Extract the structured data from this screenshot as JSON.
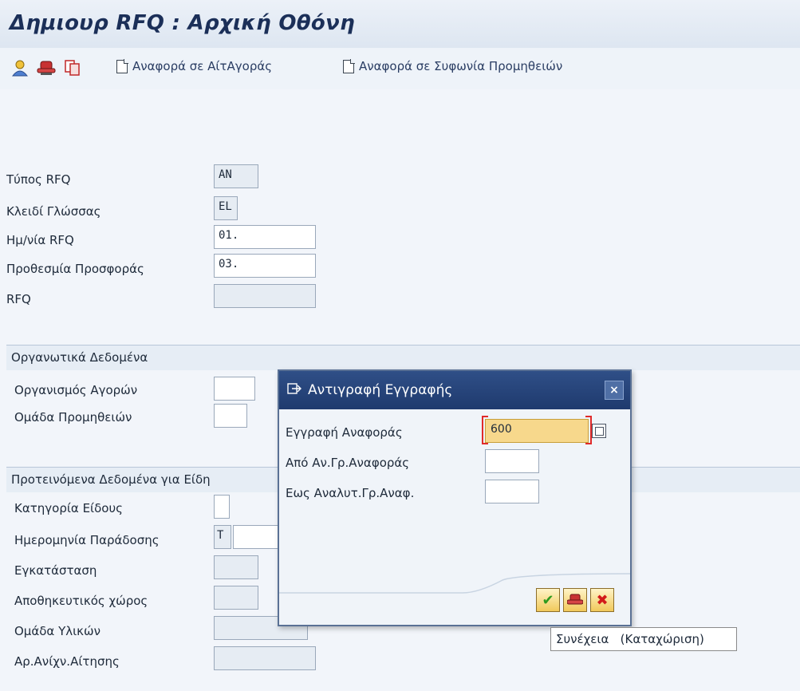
{
  "window": {
    "title": "Δημιουρ RFQ : Αρχική Οθόνη"
  },
  "toolbar": {
    "icons": [
      "person-icon",
      "hat-icon",
      "copy-icon"
    ],
    "btn_ref_request": "Αναφορά σε ΑίτΑγοράς",
    "btn_ref_agreement": "Αναφορά σε Συφωνία Προμηθειών"
  },
  "header_fields": {
    "rfq_type_label": "Τύπος RFQ",
    "rfq_type_value": "AN",
    "language_label": "Κλειδί Γλώσσας",
    "language_value": "EL",
    "rfq_date_label": "Ημ/νία RFQ",
    "rfq_date_value": "01.",
    "deadline_label": "Προθεσμία Προσφοράς",
    "deadline_value": "03.",
    "rfq_label": "RFQ",
    "rfq_value": ""
  },
  "org_section": {
    "title": "Οργανωτικά Δεδομένα",
    "purch_org_label": "Οργανισμός Αγορών",
    "purch_org_value": "",
    "purch_group_label": "Ομάδα Προμηθειών",
    "purch_group_value": ""
  },
  "item_section": {
    "title": "Προτεινόμενα Δεδομένα για Είδη",
    "item_cat_label": "Κατηγορία Είδους",
    "item_cat_value": "",
    "delivery_label": "Ημερομηνία Παράδοσης",
    "delivery_type_value": "T",
    "delivery_date_value": "",
    "plant_label": "Εγκατάσταση",
    "plant_value": "",
    "storage_label": "Αποθηκευτικός χώρος",
    "storage_value": "",
    "mat_group_label": "Ομάδα Υλικών",
    "mat_group_value": "",
    "req_no_label": "Αρ.Ανίχν.Αίτησης",
    "req_no_value": ""
  },
  "dialog": {
    "title": "Αντιγραφή Εγγραφής",
    "ref_doc_label": "Εγγραφή Αναφοράς",
    "ref_doc_value": "600",
    "from_item_label": "Από Αν.Γρ.Αναφοράς",
    "from_item_value": "",
    "to_item_label": "Εως Αναλυτ.Γρ.Αναφ.",
    "to_item_value": ""
  },
  "tooltip": {
    "text": "Συνέχεια   (Καταχώριση)"
  },
  "colors": {
    "title_text": "#1b2f58",
    "dialog_header": "#1f3a6e",
    "focus_field": "#f7d88c",
    "cancel_red": "#d21a1a",
    "confirm_green": "#2e9a1e"
  }
}
